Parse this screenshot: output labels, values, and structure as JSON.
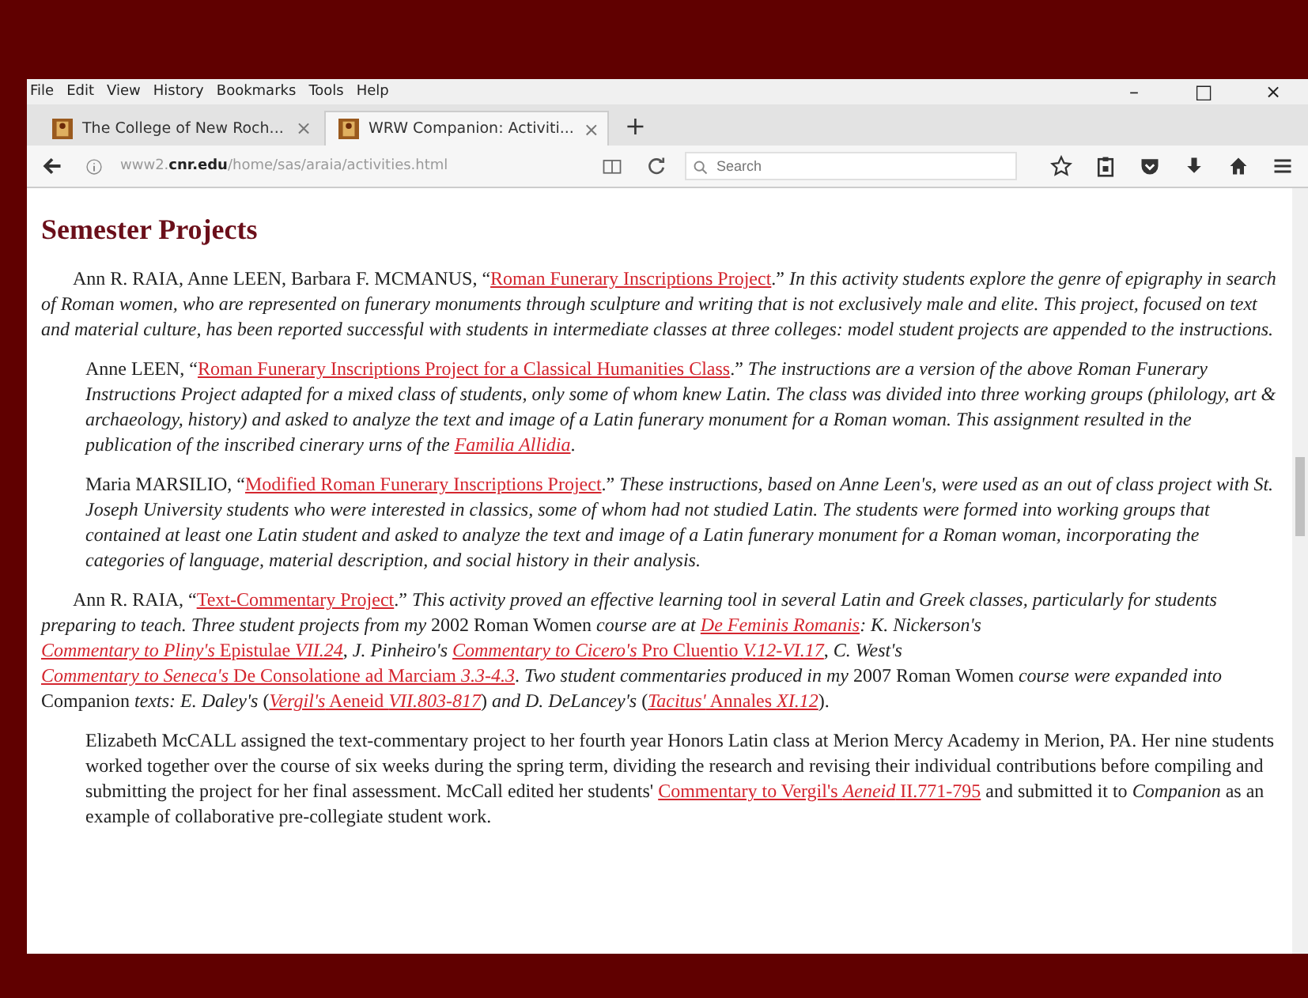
{
  "menu_bar": {
    "items": [
      "File",
      "Edit",
      "View",
      "History",
      "Bookmarks",
      "Tools",
      "Help"
    ],
    "window_controls": [
      "–",
      "□",
      "×"
    ]
  },
  "tabs": [
    {
      "title": "The College of New Roch...",
      "selected": false,
      "close": "×"
    },
    {
      "title": "WRW Companion: Activiti...",
      "selected": true,
      "close": "×"
    }
  ],
  "new_tab": "+",
  "address_bar": {
    "url": "www2.**cnr.edu**/home/sas/araia/activities.html"
  },
  "search": {
    "placeholder": "Search"
  },
  "page": {
    "heading": "Semester Projects",
    "paragraphs": [
      {
        "indented": false,
        "segments": [
          {
            "kind": "text",
            "t": "Ann R. RAIA, Anne LEEN, Barbara F. MCMANUS, “"
          },
          {
            "kind": "link",
            "t": "Roman Funerary Inscriptions Project"
          },
          {
            "kind": "text",
            "t": ".” *In this activity students explore the genre of epigraphy in search of Roman women, who are represented on funerary monuments through sculpture and writing that is not exclusively male and elite. This project, focused on text and material culture, has been reported successful with students in intermediate classes at three colleges: model student projects are appended to the instructions.*"
          }
        ]
      },
      {
        "indented": true,
        "segments": [
          {
            "kind": "text",
            "t": "Anne LEEN, “"
          },
          {
            "kind": "link",
            "t": "Roman Funerary Inscriptions Project for a Classical Humanities Class"
          },
          {
            "kind": "text",
            "t": ".” *The instructions are a version of the above Roman Funerary Instructions Project adapted for a mixed class of students, only some of whom knew Latin. The class was divided into three working groups (philology, art & archaeology, history) and asked to analyze the text and image of a Latin funerary monument for a Roman woman. This assignment resulted in the publication of the inscribed cinerary urns of the* "
          },
          {
            "kind": "link",
            "t": "*Familia Allidia*"
          },
          {
            "kind": "text",
            "t": "."
          }
        ]
      },
      {
        "indented": true,
        "segments": [
          {
            "kind": "text",
            "t": "Maria MARSILIO, “"
          },
          {
            "kind": "link",
            "t": "Modified Roman Funerary Inscriptions Project"
          },
          {
            "kind": "text",
            "t": ".” *These instructions, based on Anne Leen's, were used as an out of class project with St. Joseph University students who were interested in classics, some of whom had not studied Latin. The students were formed into working groups that contained at least one Latin student and asked to analyze the text and image of a Latin funerary monument for a Roman woman, incorporating the categories of language, material description, and social history in their analysis.*"
          }
        ]
      },
      {
        "indented": false,
        "segments": [
          {
            "kind": "text",
            "t": "Ann R. RAIA, “"
          },
          {
            "kind": "link",
            "t": "Text-Commentary Project"
          },
          {
            "kind": "text",
            "t": ".” *This activity proved an effective learning tool in several Latin and Greek classes, particularly for students preparing to teach. Three student projects from my* 2002 Roman Women *course are at* "
          },
          {
            "kind": "link",
            "t": "*De Feminis Romanis*"
          },
          {
            "kind": "text",
            "t": "*: K. Nickerson's* "
          },
          {
            "kind": "link",
            "t": "*Commentary to Pliny's* Epistulae *VII.24*"
          },
          {
            "kind": "text",
            "t": ", *J. Pinheiro's* "
          },
          {
            "kind": "link",
            "t": "*Commentary to Cicero's* Pro Cluentio *V.12-VI.17*"
          },
          {
            "kind": "text",
            "t": ", *C. West's* "
          },
          {
            "kind": "link",
            "t": "*Commentary to Seneca's* De Consolatione ad Marciam *3.3-4.3*"
          },
          {
            "kind": "text",
            "t": ". *Two student commentaries produced in my* 2007 Roman Women *course were expanded into* Companion *texts: E. Daley's* ("
          },
          {
            "kind": "link",
            "t": "*Vergil's* Aeneid *VII.803-817*"
          },
          {
            "kind": "text",
            "t": ") *and D. DeLancey's* ("
          },
          {
            "kind": "link",
            "t": "*Tacitus'* Annales *XI.12*"
          },
          {
            "kind": "text",
            "t": ")."
          }
        ]
      },
      {
        "indented": true,
        "segments": [
          {
            "kind": "text",
            "t": "Elizabeth McCALL assigned the text-commentary project to her fourth year Honors Latin class at Merion Mercy Academy in Merion, PA. Her nine students worked together over the course of six weeks during the spring term, dividing the research and revising their individual contributions before compiling and submitting the project for her final assessment. McCall edited her students' "
          },
          {
            "kind": "link",
            "t": "Commentary to Vergil's *Aeneid* II.771-795"
          },
          {
            "kind": "text",
            "t": " and submitted it to *Companion* as an example of collaborative pre-collegiate student work."
          }
        ]
      }
    ]
  }
}
